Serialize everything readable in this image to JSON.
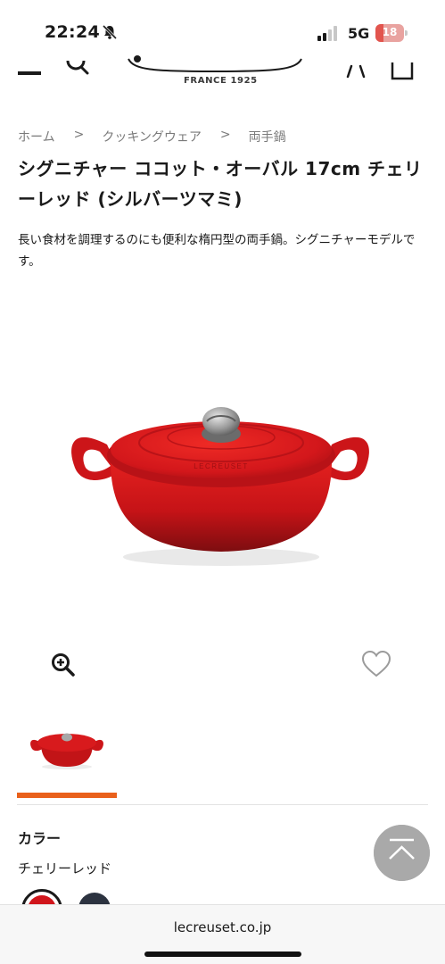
{
  "status_bar": {
    "time": "22:24",
    "network": "5G",
    "battery_percent": "18",
    "battery_color": "#e2554e"
  },
  "header": {
    "logo_tagline": "FRANCE 1925",
    "icons": [
      "menu-icon",
      "search-icon",
      "account-icon",
      "cart-icon"
    ]
  },
  "breadcrumb": {
    "items": [
      "ホーム",
      "クッキングウェア",
      "両手鍋"
    ],
    "separator": ">"
  },
  "product": {
    "title": "シグニチャー ココット・オーバル 17cm チェリーレッド (シルバーツマミ)",
    "description": "長い食材を調理するのにも便利な楕円型の両手鍋。シグニチャーモデルです。",
    "image_label": "LECREUSET"
  },
  "gallery": {
    "active_index": 0,
    "indicator_color": "#e9601b"
  },
  "color": {
    "heading": "カラー",
    "selected": "チェリーレッド",
    "swatches": [
      "#d0151b",
      "#2c3340"
    ]
  },
  "browser": {
    "url": "lecreuset.co.jp"
  }
}
